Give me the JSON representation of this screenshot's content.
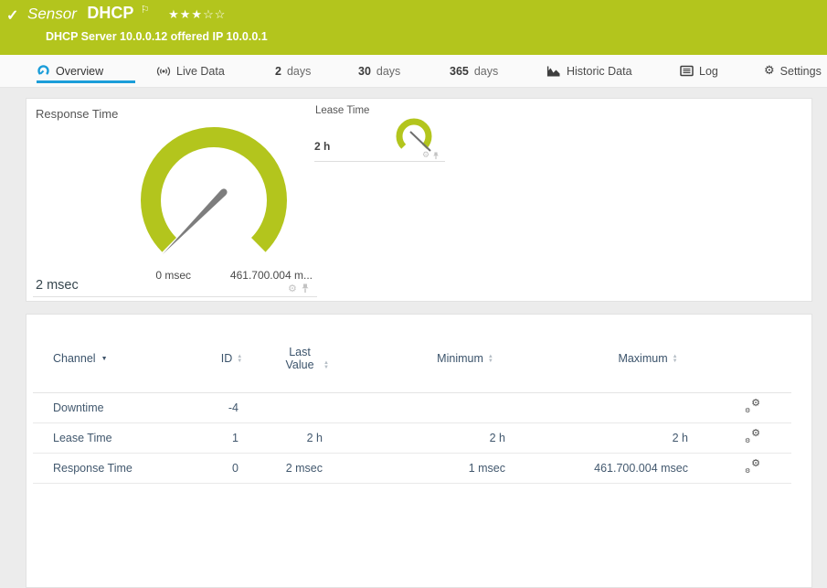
{
  "header": {
    "check_icon": "✓",
    "kind": "Sensor",
    "name": "DHCP",
    "flag_icon": "⚐",
    "stars_filled": "★★★",
    "stars_empty": "☆☆",
    "subtitle": "DHCP Server 10.0.0.12 offered IP 10.0.0.1"
  },
  "tabs": {
    "overview": "Overview",
    "live_data": "Live Data",
    "d2_num": "2",
    "d2_label": "days",
    "d30_num": "30",
    "d30_label": "days",
    "d365_num": "365",
    "d365_label": "days",
    "historic": "Historic Data",
    "log": "Log",
    "settings": "Settings"
  },
  "gauges": {
    "response": {
      "title": "Response Time",
      "value": "2 msec",
      "scale_min": "0 msec",
      "scale_max": "461.700.004 m..."
    },
    "lease": {
      "title": "Lease Time",
      "value": "2 h"
    }
  },
  "table": {
    "headers": {
      "channel": "Channel",
      "id": "ID",
      "last_value": "Last Value",
      "minimum": "Minimum",
      "maximum": "Maximum"
    },
    "rows": [
      {
        "channel": "Downtime",
        "id": "-4",
        "last": "",
        "min": "",
        "max": ""
      },
      {
        "channel": "Lease Time",
        "id": "1",
        "last": "2 h",
        "min": "2 h",
        "max": "2 h"
      },
      {
        "channel": "Response Time",
        "id": "0",
        "last": "2 msec",
        "min": "1 msec",
        "max": "461.700.004 msec"
      }
    ]
  },
  "colors": {
    "accent_green": "#b3c51d",
    "accent_blue": "#1b9dd9",
    "needle_gray": "#7d7d7d"
  }
}
